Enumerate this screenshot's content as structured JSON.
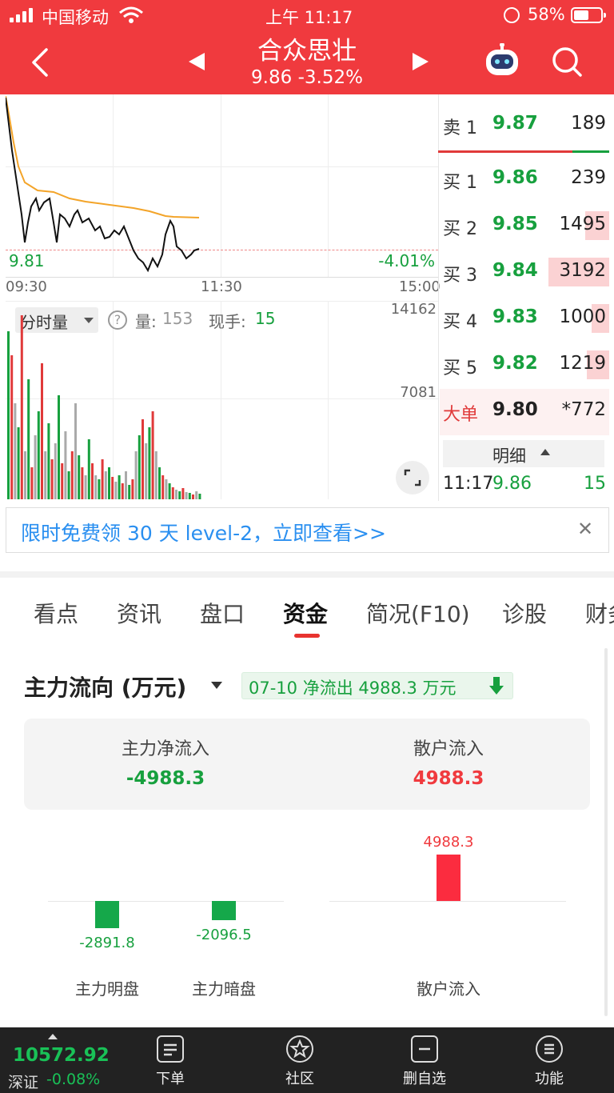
{
  "status_bar": {
    "carrier": "中国移动",
    "time": "上午 11:17",
    "battery": "58%"
  },
  "header": {
    "stock_name": "合众思壮",
    "price_change": "9.86 -3.52%"
  },
  "intraday": {
    "price_label": "9.81",
    "pct_label": "-4.01%",
    "times": [
      "09:30",
      "11:30",
      "15:00"
    ]
  },
  "volume": {
    "dropdown": "分时量",
    "vol_label": "量:",
    "vol_value": "153",
    "hand_label": "现手:",
    "hand_value": "15",
    "max_label": "14162",
    "mid_label": "7081"
  },
  "order_book": {
    "sell": [
      {
        "label": "卖 1",
        "price": "9.87",
        "vol": "189"
      }
    ],
    "buy": [
      {
        "label": "买 1",
        "price": "9.86",
        "vol": "239"
      },
      {
        "label": "买 2",
        "price": "9.85",
        "vol": "1495"
      },
      {
        "label": "买 3",
        "price": "9.84",
        "vol": "3192"
      },
      {
        "label": "买 4",
        "price": "9.83",
        "vol": "1000"
      },
      {
        "label": "买 5",
        "price": "9.82",
        "vol": "1219"
      }
    ],
    "big": {
      "label": "大单",
      "price": "9.80",
      "vol": "*772"
    },
    "detail_title": "明细",
    "detail_row": {
      "time": "11:17",
      "price": "9.86",
      "vol": "15"
    }
  },
  "banner": {
    "text": "限时免费领 30 天 level-2，立即查看>>"
  },
  "tabs": [
    "看点",
    "资讯",
    "盘口",
    "资金",
    "简况(F10)",
    "诊股",
    "财务"
  ],
  "fund": {
    "title": "主力流向 (万元)",
    "badge": "07-10 净流出 4988.3 万元",
    "summary": [
      {
        "label": "主力净流入",
        "value": "-4988.3"
      },
      {
        "label": "散户流入",
        "value": "4988.3"
      }
    ],
    "bars": [
      {
        "label": "主力明盘",
        "value": -2891.8,
        "text": "-2891.8"
      },
      {
        "label": "主力暗盘",
        "value": -2096.5,
        "text": "-2096.5"
      },
      {
        "label": "散户流入",
        "value": 4988.3,
        "text": "4988.3"
      }
    ]
  },
  "bottom_nav": {
    "index_value": "10572.92",
    "index_name": "深证",
    "index_change": "-0.08%",
    "items": [
      "下单",
      "社区",
      "删自选",
      "功能"
    ]
  },
  "colors": {
    "red": "#f03a3e",
    "green": "#17a03e",
    "avg_line": "#f3a429"
  }
}
